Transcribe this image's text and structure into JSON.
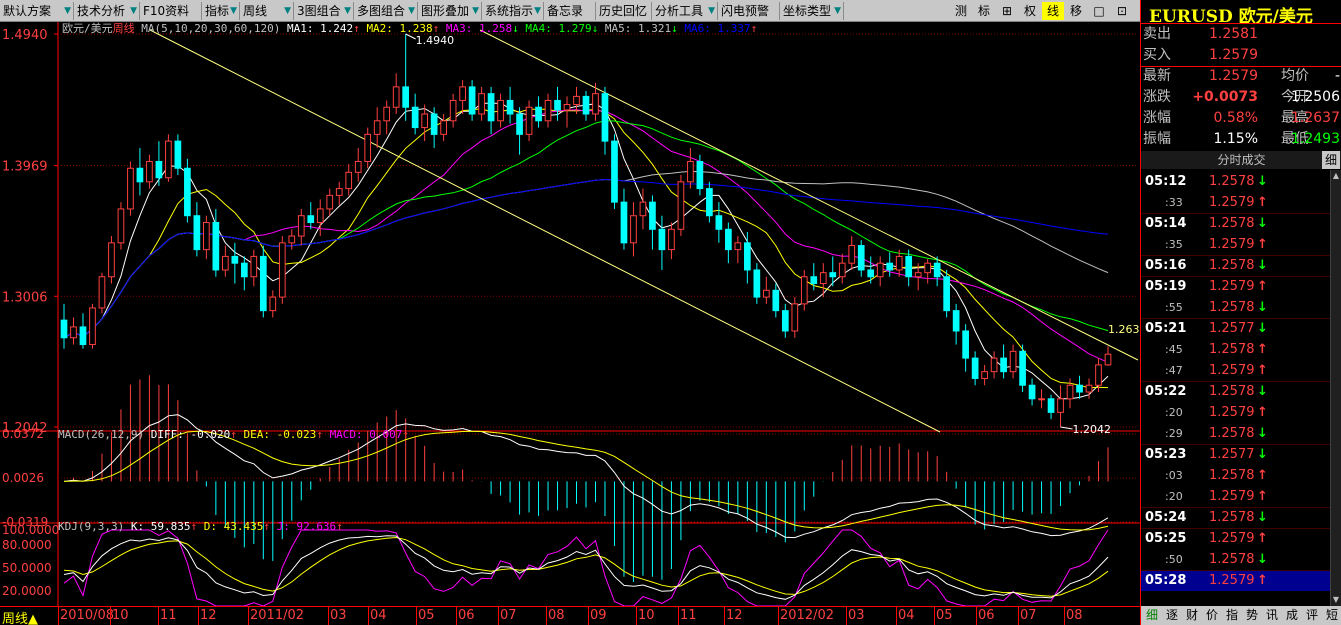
{
  "toolbar": {
    "items": [
      {
        "label": "默认方案",
        "arrow": true
      },
      {
        "label": "技术分析",
        "arrow": true
      },
      {
        "label": "F10资料",
        "arrow": false
      },
      {
        "label": "指标",
        "arrow": true
      },
      {
        "label": "周线",
        "arrow": true
      },
      {
        "label": "3图组合",
        "arrow": true
      },
      {
        "label": "多图组合",
        "arrow": true
      },
      {
        "label": "图形叠加",
        "arrow": true
      },
      {
        "label": "系统指示",
        "arrow": true
      },
      {
        "label": "备忘录",
        "arrow": false
      },
      {
        "label": "历史回忆",
        "arrow": false
      },
      {
        "label": "分析工具",
        "arrow": true
      },
      {
        "label": "闪电预警",
        "arrow": false
      },
      {
        "label": "坐标类型",
        "arrow": true
      }
    ],
    "right_buttons": [
      "测",
      "标",
      "⊞",
      "权",
      "线",
      "移",
      "□",
      "⊡",
      "×"
    ],
    "active_right": "线"
  },
  "colors": {
    "red": "#ff4040",
    "green": "#00ff00",
    "candle_up": "#ff4040",
    "candle_down": "#00ffff",
    "ma1": "#ffffff",
    "ma2": "#ffff00",
    "ma3": "#ff00ff",
    "ma4": "#00ff00",
    "ma5": "#c0c0c0",
    "ma6": "#0000ff",
    "trendline": "#ffff80"
  },
  "main_chart": {
    "symbol_label": "欧元/美元",
    "period_label": "周线",
    "ma_params": "MA(5,10,20,30,60,120)",
    "ma_values": [
      {
        "label": "MA1: 1.242",
        "arrow": "↑",
        "color": "#ffffff"
      },
      {
        "label": "MA2: 1.238",
        "arrow": "↑",
        "color": "#ffff00"
      },
      {
        "label": "MA3: 1.258",
        "arrow": "↓",
        "color": "#ff00ff"
      },
      {
        "label": "MA4: 1.279",
        "arrow": "↓",
        "color": "#00ff00"
      },
      {
        "label": "MA5: 1.321",
        "arrow": "↓",
        "color": "#c0c0c0"
      },
      {
        "label": "MA6: 1.337",
        "arrow": "↑",
        "color": "#0000ff"
      }
    ],
    "y_ticks": [
      "1.4940",
      "1.3969",
      "1.3006",
      "1.2042"
    ],
    "high_label": "1.4940",
    "low_label": "1.2042",
    "right_label": "1.263"
  },
  "macd": {
    "title": "MACD(26,12,9)",
    "diff": "DIFF: -0.020",
    "dea": "DEA: -0.023",
    "macd": "MACD: 0.007",
    "y_ticks": [
      "0.0372",
      "0.0026",
      "-0.0319"
    ]
  },
  "kdj": {
    "title": "KDJ(9,3,3)",
    "k": "K: 59.835",
    "d": "D: 43.435",
    "j": "J: 92.636",
    "y_ticks": [
      "100.0000",
      "80.0000",
      "50.0000",
      "20.0000"
    ]
  },
  "x_axis": {
    "period_label": "周线",
    "labels": [
      "2010/08",
      "10",
      "11",
      "12",
      "2011/02",
      "03",
      "04",
      "05",
      "06",
      "07",
      "08",
      "09",
      "10",
      "11",
      "12",
      "2012/02",
      "03",
      "04",
      "05",
      "06",
      "07",
      "08"
    ]
  },
  "quote": {
    "symbol_code": "EURUSD",
    "symbol_name": "欧元/美元",
    "sell_label": "卖出",
    "sell": "1.2581",
    "buy_label": "买入",
    "buy": "1.2579",
    "last_label": "最新",
    "last": "1.2579",
    "avg_label": "均价",
    "avg": "-",
    "change_label": "涨跌",
    "change": "+0.0073",
    "open_label": "今开",
    "open": "1.2506",
    "pct_label": "涨幅",
    "pct": "0.58%",
    "high_label": "最高",
    "high": "1.2637",
    "amp_label": "振幅",
    "amp": "1.15%",
    "low_label": "最低",
    "low": "1.2493"
  },
  "ticks": {
    "header": "分时成交",
    "side_btn": "细",
    "rows": [
      {
        "time": "05:12",
        "sub": false,
        "price": "1.2578",
        "dir": "down"
      },
      {
        "time": ":33",
        "sub": true,
        "price": "1.2579",
        "dir": "up"
      },
      {
        "time": "05:14",
        "sub": false,
        "price": "1.2578",
        "dir": "down"
      },
      {
        "time": ":35",
        "sub": true,
        "price": "1.2579",
        "dir": "up"
      },
      {
        "time": "05:16",
        "sub": false,
        "price": "1.2578",
        "dir": "down"
      },
      {
        "time": "05:19",
        "sub": false,
        "price": "1.2579",
        "dir": "up"
      },
      {
        "time": ":55",
        "sub": true,
        "price": "1.2578",
        "dir": "down"
      },
      {
        "time": "05:21",
        "sub": false,
        "price": "1.2577",
        "dir": "down"
      },
      {
        "time": ":45",
        "sub": true,
        "price": "1.2578",
        "dir": "up"
      },
      {
        "time": ":47",
        "sub": true,
        "price": "1.2579",
        "dir": "up"
      },
      {
        "time": "05:22",
        "sub": false,
        "price": "1.2578",
        "dir": "down"
      },
      {
        "time": ":20",
        "sub": true,
        "price": "1.2579",
        "dir": "up"
      },
      {
        "time": ":29",
        "sub": true,
        "price": "1.2578",
        "dir": "down"
      },
      {
        "time": "05:23",
        "sub": false,
        "price": "1.2577",
        "dir": "down"
      },
      {
        "time": ":03",
        "sub": true,
        "price": "1.2578",
        "dir": "up"
      },
      {
        "time": ":20",
        "sub": true,
        "price": "1.2579",
        "dir": "up"
      },
      {
        "time": "05:24",
        "sub": false,
        "price": "1.2578",
        "dir": "down"
      },
      {
        "time": "05:25",
        "sub": false,
        "price": "1.2579",
        "dir": "up"
      },
      {
        "time": ":50",
        "sub": true,
        "price": "1.2578",
        "dir": "down"
      },
      {
        "time": "05:28",
        "sub": false,
        "price": "1.2579",
        "dir": "up",
        "selected": true
      }
    ]
  },
  "bottom_tabs": [
    "细",
    "逐",
    "财",
    "价",
    "指",
    "势",
    "讯",
    "成",
    "评",
    "短"
  ],
  "chart_data": {
    "type": "candlestick",
    "title": "欧元/美元 周线",
    "period": "weekly",
    "x_range": [
      "2010/08",
      "2012/08"
    ],
    "ylim": [
      1.2042,
      1.494
    ],
    "candles": [
      [
        1.283,
        1.27,
        1.295,
        1.262
      ],
      [
        1.27,
        1.278,
        1.285,
        1.265
      ],
      [
        1.278,
        1.265,
        1.288,
        1.262
      ],
      [
        1.265,
        1.292,
        1.295,
        1.262
      ],
      [
        1.292,
        1.315,
        1.318,
        1.288
      ],
      [
        1.315,
        1.34,
        1.345,
        1.31
      ],
      [
        1.34,
        1.365,
        1.37,
        1.335
      ],
      [
        1.365,
        1.395,
        1.4,
        1.36
      ],
      [
        1.395,
        1.385,
        1.41,
        1.375
      ],
      [
        1.385,
        1.4,
        1.405,
        1.38
      ],
      [
        1.4,
        1.388,
        1.415,
        1.382
      ],
      [
        1.388,
        1.415,
        1.42,
        1.385
      ],
      [
        1.415,
        1.395,
        1.42,
        1.39
      ],
      [
        1.395,
        1.36,
        1.402,
        1.355
      ],
      [
        1.36,
        1.335,
        1.37,
        1.33
      ],
      [
        1.335,
        1.355,
        1.36,
        1.328
      ],
      [
        1.355,
        1.32,
        1.365,
        1.315
      ],
      [
        1.32,
        1.33,
        1.338,
        1.315
      ],
      [
        1.33,
        1.325,
        1.34,
        1.31
      ],
      [
        1.325,
        1.315,
        1.33,
        1.305
      ],
      [
        1.315,
        1.33,
        1.335,
        1.308
      ],
      [
        1.33,
        1.29,
        1.338,
        1.285
      ],
      [
        1.29,
        1.3,
        1.305,
        1.285
      ],
      [
        1.3,
        1.34,
        1.345,
        1.295
      ],
      [
        1.34,
        1.345,
        1.35,
        1.335
      ],
      [
        1.345,
        1.36,
        1.365,
        1.338
      ],
      [
        1.36,
        1.355,
        1.37,
        1.35
      ],
      [
        1.355,
        1.365,
        1.372,
        1.345
      ],
      [
        1.365,
        1.375,
        1.38,
        1.36
      ],
      [
        1.375,
        1.38,
        1.385,
        1.368
      ],
      [
        1.38,
        1.392,
        1.398,
        1.375
      ],
      [
        1.392,
        1.4,
        1.41,
        1.385
      ],
      [
        1.4,
        1.42,
        1.425,
        1.395
      ],
      [
        1.42,
        1.43,
        1.44,
        1.41
      ],
      [
        1.43,
        1.44,
        1.445,
        1.42
      ],
      [
        1.44,
        1.455,
        1.465,
        1.435
      ],
      [
        1.455,
        1.44,
        1.494,
        1.43
      ],
      [
        1.44,
        1.425,
        1.45,
        1.42
      ],
      [
        1.425,
        1.435,
        1.442,
        1.415
      ],
      [
        1.435,
        1.42,
        1.44,
        1.41
      ],
      [
        1.42,
        1.43,
        1.435,
        1.415
      ],
      [
        1.43,
        1.445,
        1.45,
        1.425
      ],
      [
        1.445,
        1.455,
        1.46,
        1.435
      ],
      [
        1.455,
        1.435,
        1.46,
        1.43
      ],
      [
        1.435,
        1.45,
        1.455,
        1.43
      ],
      [
        1.45,
        1.43,
        1.455,
        1.42
      ],
      [
        1.43,
        1.445,
        1.45,
        1.425
      ],
      [
        1.445,
        1.435,
        1.455,
        1.428
      ],
      [
        1.435,
        1.42,
        1.44,
        1.405
      ],
      [
        1.42,
        1.44,
        1.445,
        1.415
      ],
      [
        1.44,
        1.43,
        1.448,
        1.425
      ],
      [
        1.43,
        1.445,
        1.45,
        1.425
      ],
      [
        1.445,
        1.438,
        1.455,
        1.43
      ],
      [
        1.438,
        1.442,
        1.448,
        1.425
      ],
      [
        1.442,
        1.448,
        1.455,
        1.435
      ],
      [
        1.448,
        1.435,
        1.452,
        1.43
      ],
      [
        1.435,
        1.45,
        1.458,
        1.43
      ],
      [
        1.45,
        1.415,
        1.455,
        1.405
      ],
      [
        1.415,
        1.37,
        1.42,
        1.365
      ],
      [
        1.37,
        1.34,
        1.38,
        1.335
      ],
      [
        1.34,
        1.36,
        1.37,
        1.33
      ],
      [
        1.36,
        1.37,
        1.38,
        1.35
      ],
      [
        1.37,
        1.35,
        1.375,
        1.335
      ],
      [
        1.35,
        1.335,
        1.36,
        1.32
      ],
      [
        1.335,
        1.35,
        1.355,
        1.328
      ],
      [
        1.35,
        1.385,
        1.39,
        1.345
      ],
      [
        1.385,
        1.4,
        1.41,
        1.38
      ],
      [
        1.4,
        1.38,
        1.405,
        1.375
      ],
      [
        1.38,
        1.36,
        1.385,
        1.355
      ],
      [
        1.36,
        1.35,
        1.37,
        1.34
      ],
      [
        1.35,
        1.335,
        1.355,
        1.325
      ],
      [
        1.335,
        1.34,
        1.345,
        1.325
      ],
      [
        1.34,
        1.32,
        1.348,
        1.31
      ],
      [
        1.32,
        1.3,
        1.325,
        1.295
      ],
      [
        1.3,
        1.305,
        1.315,
        1.295
      ],
      [
        1.305,
        1.29,
        1.31,
        1.285
      ],
      [
        1.29,
        1.275,
        1.295,
        1.27
      ],
      [
        1.275,
        1.295,
        1.3,
        1.27
      ],
      [
        1.295,
        1.315,
        1.32,
        1.29
      ],
      [
        1.315,
        1.31,
        1.325,
        1.305
      ],
      [
        1.31,
        1.318,
        1.325,
        1.3
      ],
      [
        1.318,
        1.315,
        1.33,
        1.308
      ],
      [
        1.315,
        1.325,
        1.332,
        1.31
      ],
      [
        1.325,
        1.338,
        1.345,
        1.32
      ],
      [
        1.338,
        1.32,
        1.342,
        1.315
      ],
      [
        1.32,
        1.315,
        1.33,
        1.31
      ],
      [
        1.315,
        1.325,
        1.33,
        1.308
      ],
      [
        1.325,
        1.32,
        1.333,
        1.315
      ],
      [
        1.32,
        1.33,
        1.335,
        1.315
      ],
      [
        1.33,
        1.315,
        1.335,
        1.308
      ],
      [
        1.315,
        1.318,
        1.325,
        1.305
      ],
      [
        1.318,
        1.325,
        1.328,
        1.31
      ],
      [
        1.325,
        1.315,
        1.33,
        1.308
      ],
      [
        1.315,
        1.29,
        1.32,
        1.285
      ],
      [
        1.29,
        1.275,
        1.295,
        1.265
      ],
      [
        1.275,
        1.255,
        1.28,
        1.245
      ],
      [
        1.255,
        1.24,
        1.26,
        1.235
      ],
      [
        1.24,
        1.245,
        1.25,
        1.235
      ],
      [
        1.245,
        1.255,
        1.26,
        1.24
      ],
      [
        1.255,
        1.245,
        1.265,
        1.24
      ],
      [
        1.245,
        1.26,
        1.265,
        1.24
      ],
      [
        1.26,
        1.235,
        1.265,
        1.23
      ],
      [
        1.235,
        1.225,
        1.24,
        1.22
      ],
      [
        1.225,
        1.225,
        1.232,
        1.218
      ],
      [
        1.225,
        1.215,
        1.228,
        1.21
      ],
      [
        1.215,
        1.225,
        1.235,
        1.2042
      ],
      [
        1.225,
        1.235,
        1.24,
        1.218
      ],
      [
        1.235,
        1.23,
        1.242,
        1.225
      ],
      [
        1.23,
        1.235,
        1.24,
        1.225
      ],
      [
        1.235,
        1.25,
        1.255,
        1.23
      ],
      [
        1.25,
        1.2579,
        1.2637,
        1.2493
      ]
    ],
    "candle_fields": [
      "open",
      "close",
      "high",
      "low"
    ],
    "annotations": [
      {
        "label": "1.4940",
        "type": "high"
      },
      {
        "label": "1.2042",
        "type": "low"
      },
      {
        "label": "1.263",
        "type": "trendline"
      }
    ],
    "grid": true
  }
}
